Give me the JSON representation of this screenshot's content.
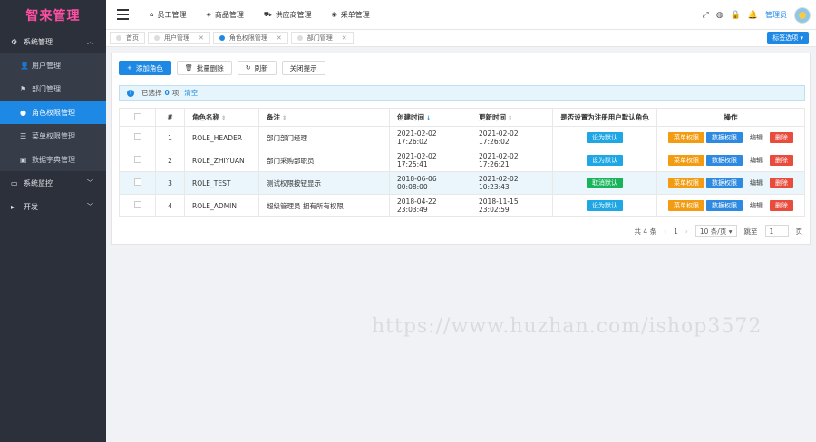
{
  "sidebar": {
    "logo": "智来管理",
    "groups": [
      {
        "label": "系统管理",
        "icon": "gear-icon",
        "chevron": "︿"
      },
      {
        "label": "系统监控",
        "icon": "monitor-icon",
        "chevron": "﹀"
      },
      {
        "label": "开发",
        "icon": "code-icon",
        "chevron": "﹀"
      }
    ],
    "items": [
      {
        "label": "用户管理",
        "icon": "user-icon"
      },
      {
        "label": "部门管理",
        "icon": "flag-icon"
      },
      {
        "label": "角色权限管理",
        "icon": "role-icon"
      },
      {
        "label": "菜单权限管理",
        "icon": "menu-icon"
      },
      {
        "label": "数据字典管理",
        "icon": "book-icon"
      }
    ]
  },
  "header": {
    "nav": [
      {
        "label": "员工管理",
        "icon": "home-icon"
      },
      {
        "label": "商品管理",
        "icon": "tag-icon"
      },
      {
        "label": "供应商管理",
        "icon": "truck-icon"
      },
      {
        "label": "采单管理",
        "icon": "eye-icon"
      }
    ],
    "user": "管理员"
  },
  "tabs": [
    {
      "label": "首页"
    },
    {
      "label": "用户管理"
    },
    {
      "label": "角色权限管理"
    },
    {
      "label": "部门管理"
    }
  ],
  "tab_options": "标签选项",
  "toolbar": {
    "add": "添加角色",
    "batch_delete": "批量删除",
    "refresh": "刷新",
    "close_tip": "关闭提示"
  },
  "alert": {
    "prefix": "已选择",
    "count": "0",
    "suffix": "项",
    "clear": "清空"
  },
  "table": {
    "headers": [
      "#",
      "角色名称",
      "备注",
      "创建时间",
      "更新时间",
      "是否设置为注册用户默认角色",
      "操作"
    ],
    "rows": [
      {
        "no": "1",
        "name": "ROLE_HEADER",
        "note": "部门部门经理",
        "created": "2021-02-02 17:26:02",
        "updated": "2021-02-02 17:26:02",
        "default": "设为默认",
        "highlight": false
      },
      {
        "no": "2",
        "name": "ROLE_ZHIYUAN",
        "note": "部门采购部职员",
        "created": "2021-02-02 17:25:41",
        "updated": "2021-02-02 17:26:21",
        "default": "设为默认",
        "highlight": false
      },
      {
        "no": "3",
        "name": "ROLE_TEST",
        "note": "测试权限按钮显示",
        "created": "2018-06-06 00:08:00",
        "updated": "2021-02-02 10:23:43",
        "default": "取消默认",
        "highlight": true
      },
      {
        "no": "4",
        "name": "ROLE_ADMIN",
        "note": "超级管理员 拥有所有权限",
        "created": "2018-04-22 23:03:49",
        "updated": "2018-11-15 23:02:59",
        "default": "设为默认",
        "highlight": false
      }
    ],
    "actions": {
      "menu_perm": "菜单权限",
      "data_perm": "数据权限",
      "edit": "编辑",
      "delete": "删除"
    }
  },
  "pager": {
    "total": "共 4 条",
    "page": "1",
    "size": "10 条/页",
    "goto": "跳至",
    "goto_value": "1",
    "page_suffix": "页"
  },
  "watermark": "https://www.huzhan.com/ishop3572",
  "colors": {
    "primary": "#1e88e5",
    "sidebar": "#2b303b"
  }
}
